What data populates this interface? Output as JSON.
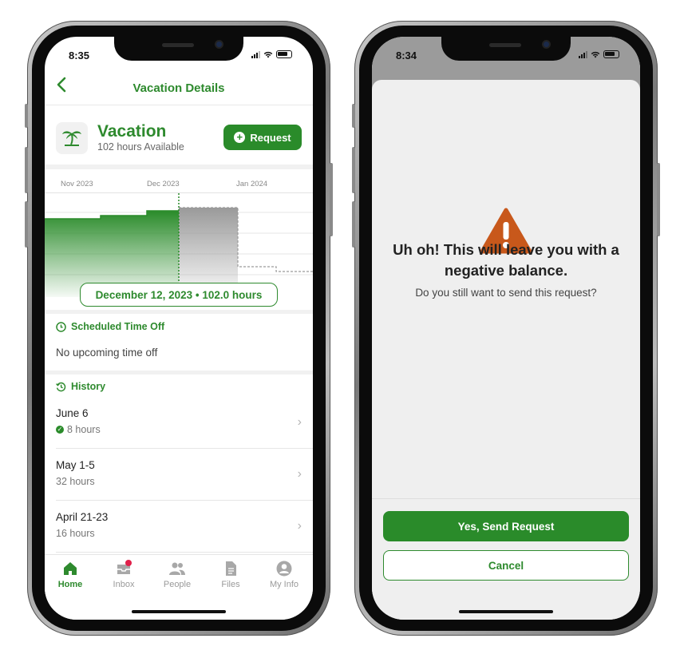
{
  "left": {
    "status": {
      "time": "8:35"
    },
    "nav": {
      "back_icon": "chevron-left-icon",
      "title": "Vacation Details"
    },
    "card": {
      "icon": "palm-tree-icon",
      "title": "Vacation",
      "subtitle": "102 hours Available",
      "request_label": "Request"
    },
    "timeline": {
      "months": [
        "Nov 2023",
        "Dec 2023",
        "Jan 2024"
      ],
      "selected_label": "December 12, 2023 • 102.0 hours"
    },
    "scheduled": {
      "heading": "Scheduled Time Off",
      "empty_text": "No upcoming time off"
    },
    "history": {
      "heading": "History",
      "items": [
        {
          "date": "June 6",
          "hours": "8 hours",
          "approved": true
        },
        {
          "date": "May 1-5",
          "hours": "32 hours",
          "approved": false
        },
        {
          "date": "April 21-23",
          "hours": "16 hours",
          "approved": false
        }
      ]
    },
    "tabs": [
      {
        "label": "Home",
        "icon": "home-icon",
        "active": true
      },
      {
        "label": "Inbox",
        "icon": "inbox-icon",
        "active": false
      },
      {
        "label": "People",
        "icon": "people-icon",
        "active": false
      },
      {
        "label": "Files",
        "icon": "file-icon",
        "active": false
      },
      {
        "label": "My Info",
        "icon": "user-icon",
        "active": false
      }
    ]
  },
  "right": {
    "status": {
      "time": "8:34"
    },
    "alert": {
      "icon": "warning-icon",
      "title": "Uh oh! This will leave you with a negative balance.",
      "message": "Do you still want to send this request?",
      "confirm_label": "Yes, Send Request",
      "cancel_label": "Cancel"
    }
  },
  "colors": {
    "brand_green": "#2a8b2a",
    "warning_orange": "#c8581b"
  }
}
